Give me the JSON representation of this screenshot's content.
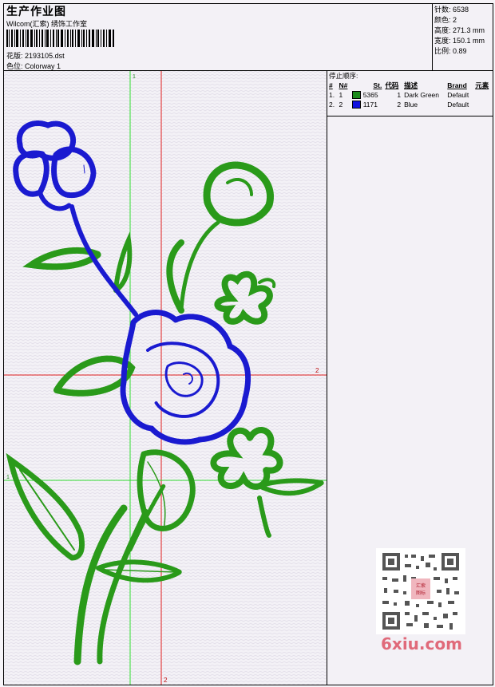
{
  "header": {
    "title": "生产作业图",
    "subtitle": "Wilcom(汇索) 绣饰工作室",
    "design_label": "花版:",
    "design_file": "2193105.dst",
    "colorway_label": "色位:",
    "colorway": "Colorway 1"
  },
  "stats": [
    {
      "label": "针数:",
      "value": "6538"
    },
    {
      "label": "颜色:",
      "value": "2"
    },
    {
      "label": "高度:",
      "value": "271.3 mm"
    },
    {
      "label": "宽度:",
      "value": "150.1 mm"
    },
    {
      "label": "比例:",
      "value": "0.89"
    }
  ],
  "stop_sequence": {
    "title": "停止顺序:",
    "columns": [
      "#",
      "N#",
      "St.",
      "代码",
      "描述",
      "Brand",
      "元素"
    ],
    "rows": [
      {
        "num": "1.",
        "n": "1",
        "color": "#1a8a1a",
        "stitches": "5365",
        "code": "1",
        "desc": "Dark Green",
        "brand": "Default"
      },
      {
        "num": "2.",
        "n": "2",
        "color": "#1010e0",
        "stitches": "1171",
        "code": "2",
        "desc": "Blue",
        "brand": "Default"
      }
    ]
  },
  "guides": {
    "label_v_green": "1",
    "label_h_red": "2",
    "label_v_red": "2",
    "label_h_green": "1"
  },
  "colors": {
    "green": "#2a9a1a",
    "blue": "#1a1ad0",
    "guide_green": "#33dd33",
    "guide_red": "#e02020"
  },
  "watermark": {
    "text": "6xiu.com",
    "stamp": "汇索图标"
  }
}
